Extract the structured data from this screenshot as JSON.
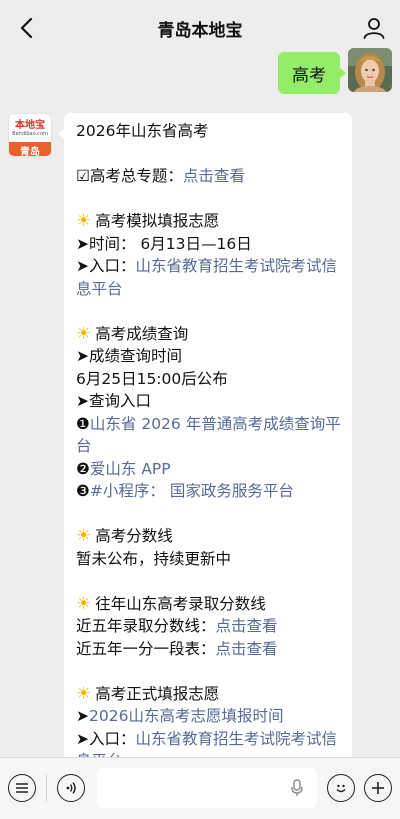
{
  "header": {
    "title": "青岛本地宝"
  },
  "user_message": {
    "text": "高考"
  },
  "bot": {
    "avatar_logo": "本地宝",
    "avatar_site": "Bendibao.com",
    "avatar_city": "青岛",
    "lines": {
      "l1": "2026年山东省高考",
      "l2_prefix": "☑高考总专题：",
      "l2_link": "点击查看",
      "s1_title": "高考模拟填报志愿",
      "s1_time": "➤时间： 6月13日—16日",
      "s1_entry_prefix": "➤入口：",
      "s1_entry_link": "山东省教育招生考试院考试信息平台",
      "s2_title": "高考成绩查询",
      "s2_l1": "➤成绩查询时间",
      "s2_l2": "6月25日15:00后公布",
      "s2_l3": "➤查询入口",
      "s2_i1_num": "❶",
      "s2_i1_link": "山东省 2026 年普通高考成绩查询平台",
      "s2_i2_num": "❷",
      "s2_i2_link": "爱山东 APP",
      "s2_i3_num": "❸",
      "s2_i3_link": "#小程序： 国家政务服务平台",
      "s3_title": "高考分数线",
      "s3_l1": "暂未公布，持续更新中",
      "s4_title": "往年山东高考录取分数线",
      "s4_l1_prefix": "近五年录取分数线：",
      "s4_l1_link": "点击查看",
      "s4_l2_prefix": "近五年一分一段表：",
      "s4_l2_link": "点击查看",
      "s5_title": "高考正式填报志愿",
      "s5_l1_prefix": "➤",
      "s5_l1_link": "2026山东高考志愿填报时间",
      "s5_l2_prefix": "➤入口：",
      "s5_l2_link": "山东省教育招生考试院考试信息平台"
    }
  },
  "colors": {
    "link": "#576b95",
    "my_bubble": "#95ec69",
    "background": "#ededed"
  },
  "icons": {
    "back": "chevron-left-icon",
    "profile": "person-icon",
    "sun": "sun-icon",
    "menu": "menu-list-icon",
    "voice": "voice-icon",
    "mic": "mic-icon",
    "emoji": "emoji-icon",
    "plus": "plus-icon"
  }
}
